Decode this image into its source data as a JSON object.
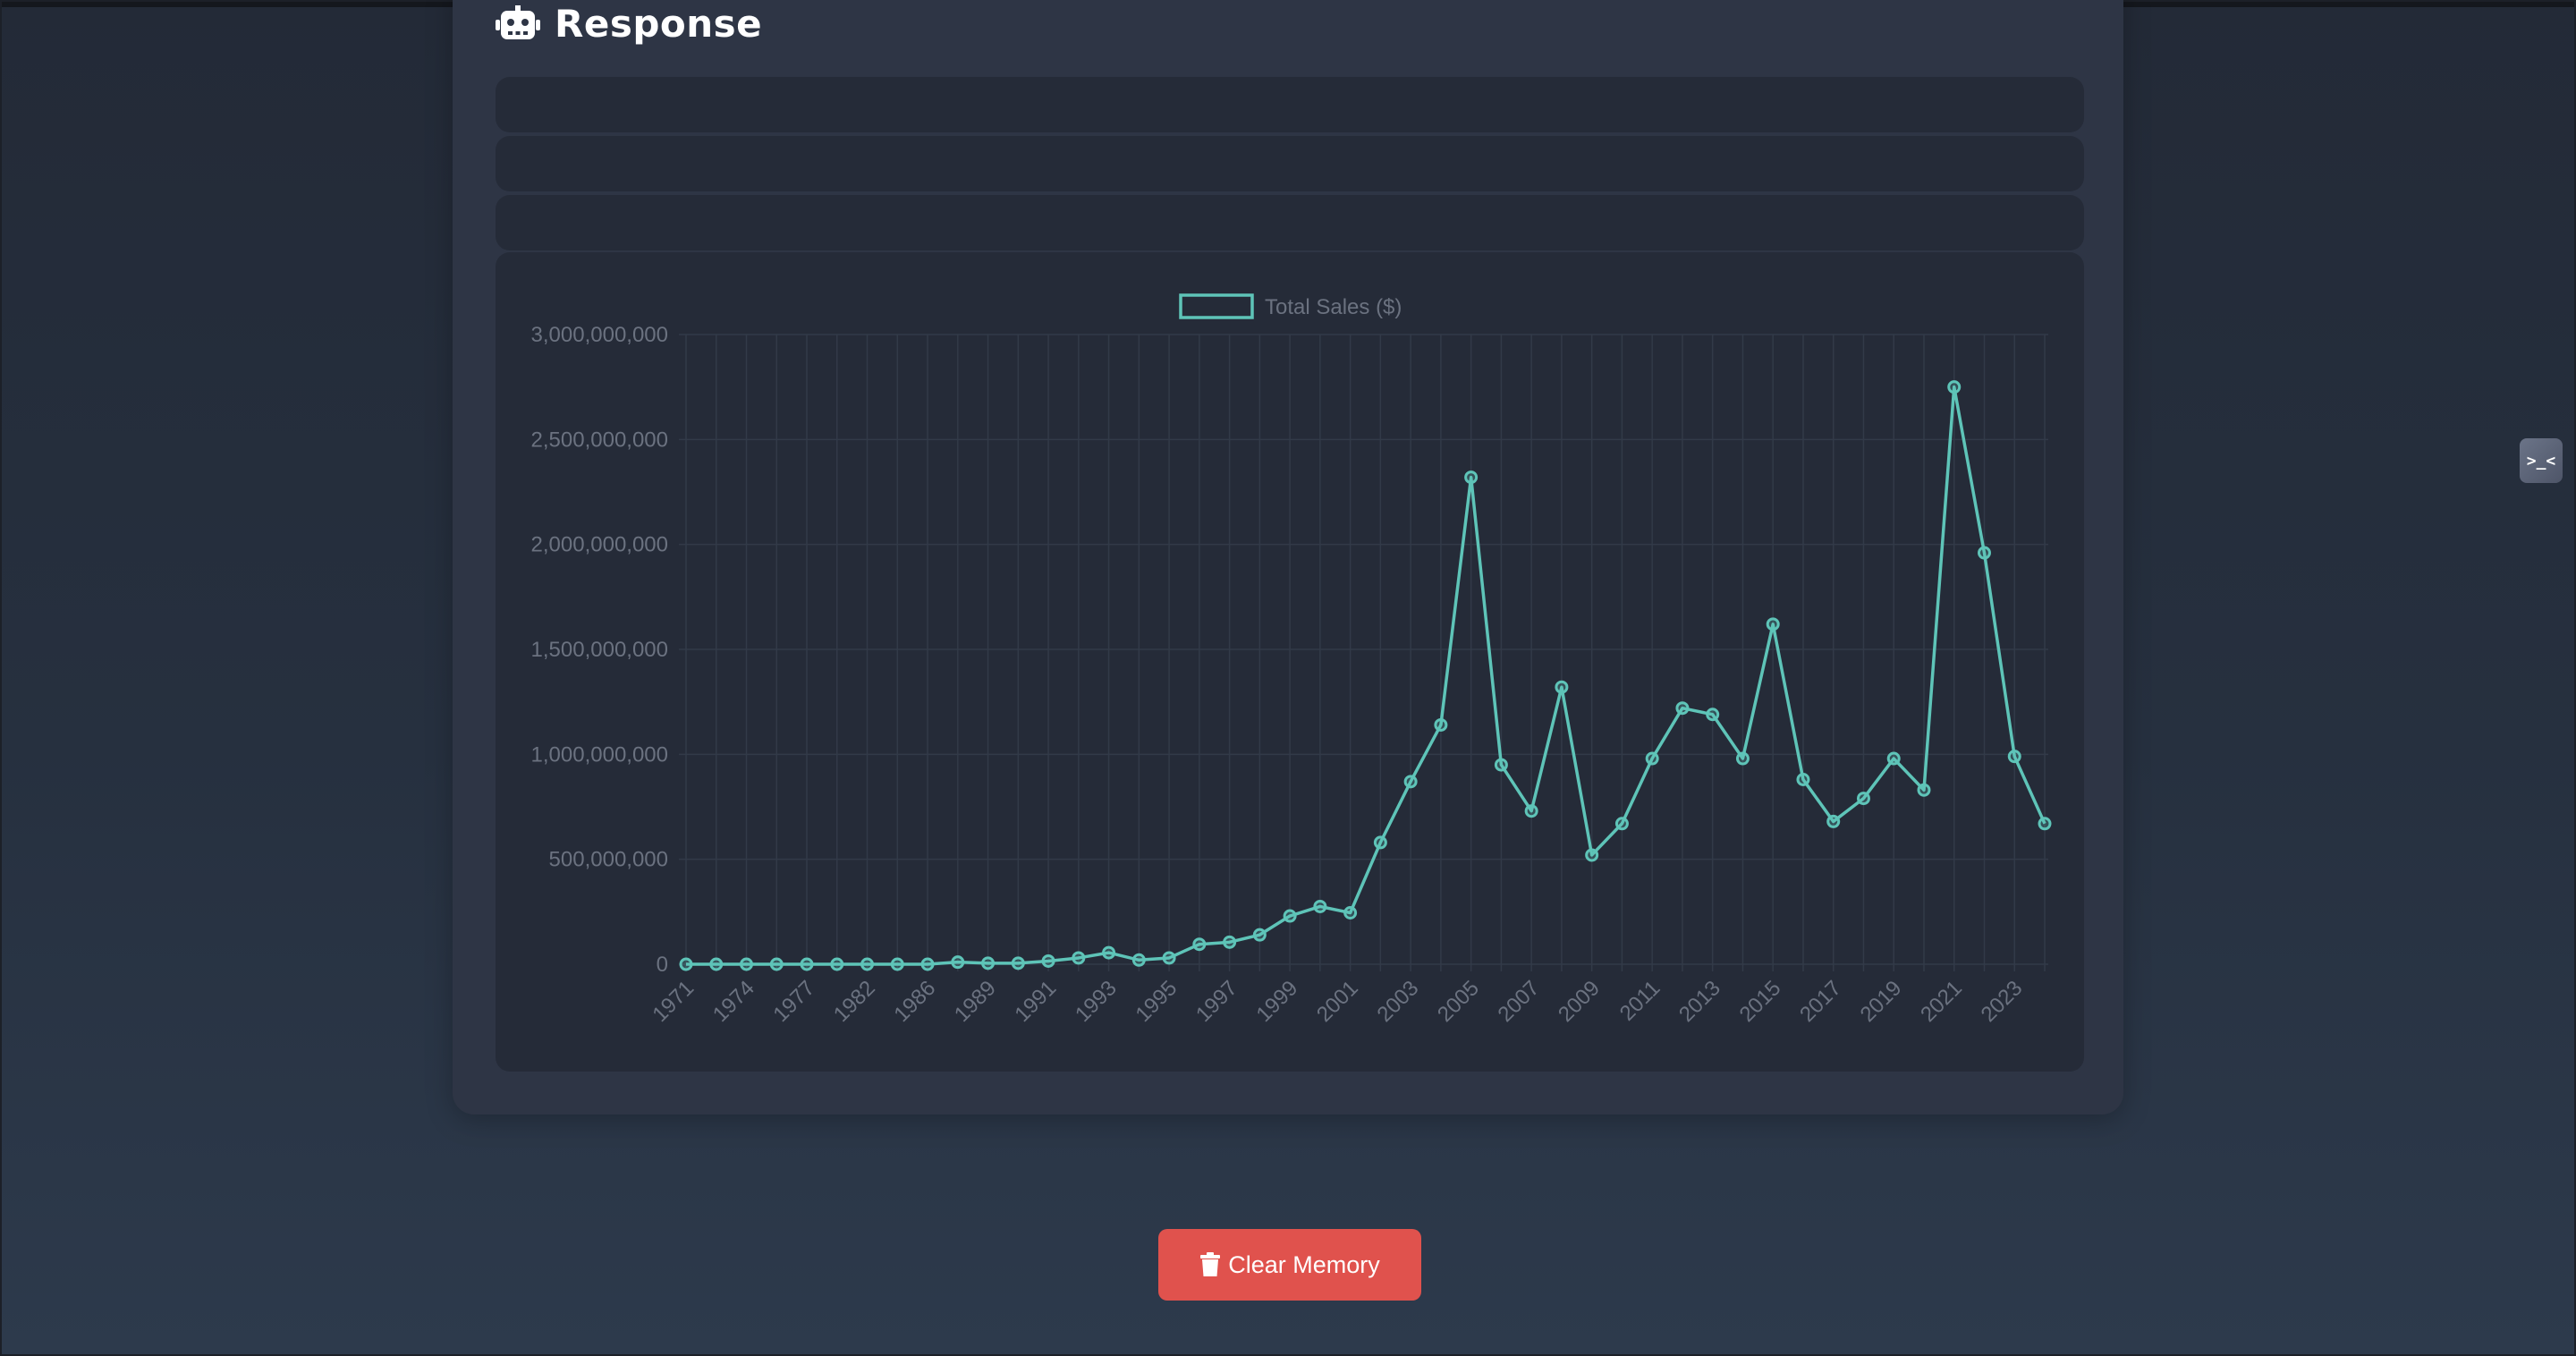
{
  "header": {
    "title": "Response"
  },
  "actions": {
    "clear_label": "Clear Memory"
  },
  "side_toggle": {
    "label": ">_<"
  },
  "chart_data": {
    "type": "line",
    "x": [
      1971,
      1972,
      1974,
      1975,
      1977,
      1980,
      1982,
      1984,
      1986,
      1987,
      1989,
      1990,
      1991,
      1992,
      1993,
      1994,
      1995,
      1996,
      1997,
      1998,
      1999,
      2000,
      2001,
      2002,
      2003,
      2004,
      2005,
      2006,
      2007,
      2008,
      2009,
      2010,
      2011,
      2012,
      2013,
      2014,
      2015,
      2016,
      2017,
      2018,
      2019,
      2020,
      2021,
      2022,
      2023,
      2024
    ],
    "xtick_labels": [
      "1971",
      "1974",
      "1977",
      "1982",
      "1986",
      "1989",
      "1991",
      "1993",
      "1995",
      "1997",
      "1999",
      "2001",
      "2003",
      "2005",
      "2007",
      "2009",
      "2011",
      "2013",
      "2015",
      "2017",
      "2019",
      "2021",
      "2023"
    ],
    "series": [
      {
        "name": "Total Sales ($)",
        "values": [
          0,
          0,
          0,
          0,
          0,
          0,
          0,
          0,
          0,
          10000000,
          5000000,
          5000000,
          15000000,
          30000000,
          55000000,
          20000000,
          30000000,
          95000000,
          105000000,
          140000000,
          230000000,
          275000000,
          245000000,
          580000000,
          870000000,
          1140000000,
          2320000000,
          950000000,
          730000000,
          1320000000,
          520000000,
          670000000,
          980000000,
          1220000000,
          1190000000,
          980000000,
          1620000000,
          880000000,
          680000000,
          790000000,
          980000000,
          830000000,
          2750000000,
          1960000000,
          990000000,
          670000000
        ]
      }
    ],
    "ylim": [
      0,
      3000000000
    ],
    "yticks": [
      "0",
      "500,000,000",
      "1,000,000,000",
      "1,500,000,000",
      "2,000,000,000",
      "2,500,000,000",
      "3,000,000,000"
    ],
    "grid": true,
    "legend": "top-center",
    "colors": {
      "line": "#5ec4b8",
      "grid": "#323a48",
      "text": "#6b7280"
    }
  }
}
